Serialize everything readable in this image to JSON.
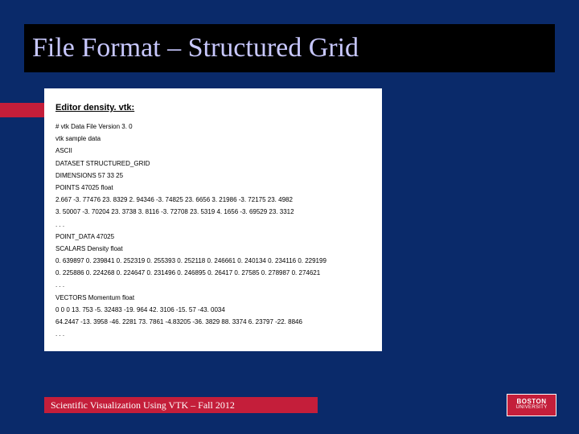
{
  "title": "File Format – Structured Grid",
  "file_heading": "Editor density. vtk:",
  "file_lines": [
    "# vtk Data File Version 3. 0",
    "vtk sample data",
    "ASCII",
    "DATASET STRUCTURED_GRID",
    "DIMENSIONS 57 33 25",
    "POINTS 47025 float",
    "2.667 -3. 77476 23. 8329 2. 94346 -3. 74825 23. 6656 3. 21986 -3. 72175 23. 4982",
    "3. 50007 -3. 70204 23. 3738 3. 8116 -3. 72708 23. 5319 4. 1656 -3. 69529 23. 3312",
    ". . .",
    "POINT_DATA 47025",
    "SCALARS Density float",
    "0. 639897 0. 239841 0. 252319 0. 255393 0. 252118 0. 246661 0. 240134 0. 234116 0. 229199",
    "0. 225886 0. 224268 0. 224647 0. 231496 0. 246895 0. 26417 0. 27585 0. 278987 0. 274621",
    ". . .",
    "VECTORS Momentum float",
    "0 0 0 13. 753 -5. 32483 -19. 964 42. 3106 -15. 57 -43. 0034",
    "64.2447 -13. 3958 -46. 2281 73. 7861 -4.83205 -36. 3829 88. 3374 6. 23797 -22. 8846",
    ". . ."
  ],
  "footer": "Scientific Visualization Using VTK – Fall 2012",
  "logo": {
    "line1": "BOSTON",
    "line2": "UNIVERSITY"
  }
}
